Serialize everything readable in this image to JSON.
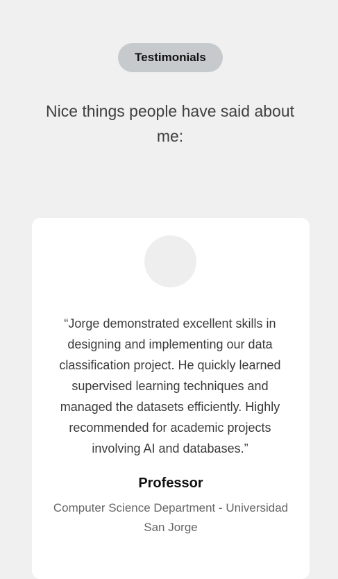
{
  "section": {
    "badge_label": "Testimonials",
    "heading": "Nice things people have said about me:"
  },
  "testimonials": [
    {
      "quote": "“Jorge demonstrated excellent skills in designing and implementing our data classification project. He quickly learned supervised learning techniques and managed the datasets efficiently. Highly recommended for academic projects involving AI and databases.”",
      "author_role": "Professor",
      "author_affiliation": "Computer Science Department - Universidad San Jorge"
    }
  ],
  "colors": {
    "page_background": "#f0f0f0",
    "badge_background": "#c6cacc",
    "card_background": "#ffffff",
    "avatar_placeholder": "#eeeeee",
    "text_primary": "#3f3f3f",
    "text_secondary": "#666666"
  }
}
